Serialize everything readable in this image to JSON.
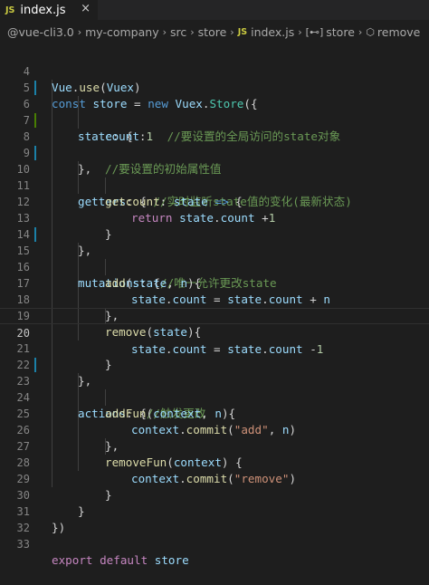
{
  "tab": {
    "icon_label": "JS",
    "title": "index.js",
    "close_glyph": "×"
  },
  "breadcrumb": {
    "items": [
      "@vue-cli3.0",
      "my-company",
      "src",
      "store"
    ],
    "file_icon": "JS",
    "file": "index.js",
    "symbol_store": "store",
    "symbol_remove": "remove"
  },
  "editor": {
    "active_line": 20,
    "lines": [
      {
        "n": "4",
        "git": ""
      },
      {
        "n": "5",
        "git": ""
      },
      {
        "n": "6",
        "git": "modified"
      },
      {
        "n": "7",
        "git": ""
      },
      {
        "n": "8",
        "git": "added"
      },
      {
        "n": "9",
        "git": ""
      },
      {
        "n": "10",
        "git": "modified"
      },
      {
        "n": "11",
        "git": ""
      },
      {
        "n": "12",
        "git": ""
      },
      {
        "n": "13",
        "git": ""
      },
      {
        "n": "14",
        "git": ""
      },
      {
        "n": "15",
        "git": "modified"
      },
      {
        "n": "16",
        "git": ""
      },
      {
        "n": "17",
        "git": ""
      },
      {
        "n": "18",
        "git": ""
      },
      {
        "n": "19",
        "git": ""
      },
      {
        "n": "20",
        "git": ""
      },
      {
        "n": "21",
        "git": ""
      },
      {
        "n": "22",
        "git": ""
      },
      {
        "n": "23",
        "git": "modified"
      },
      {
        "n": "24",
        "git": ""
      },
      {
        "n": "25",
        "git": ""
      },
      {
        "n": "26",
        "git": ""
      },
      {
        "n": "27",
        "git": ""
      },
      {
        "n": "28",
        "git": ""
      },
      {
        "n": "29",
        "git": ""
      },
      {
        "n": "30",
        "git": ""
      },
      {
        "n": "31",
        "git": ""
      },
      {
        "n": "32",
        "git": ""
      },
      {
        "n": "33",
        "git": ""
      }
    ]
  },
  "code": {
    "l4": [
      "Vue",
      ".",
      "use",
      "(",
      "Vuex",
      ")"
    ],
    "l5": [
      "const",
      " ",
      "store",
      " = ",
      "new",
      " ",
      "Vuex",
      ".",
      "Store",
      "({"
    ],
    "l6": [
      "state",
      ": {     ",
      "//要设置的全局访问的state对象"
    ],
    "l7": [
      "count",
      ":",
      "1"
    ],
    "l8": [
      "//要设置的初始属性值"
    ],
    "l9": [
      "},"
    ],
    "l10": [
      "getters",
      ": { ",
      "//实时监听state值的变化(最新状态)"
    ],
    "l11": [
      "getcount",
      ": ",
      "state",
      " ",
      "=>",
      " {"
    ],
    "l12": [
      "return",
      " ",
      "state",
      ".",
      "count",
      " +",
      "1"
    ],
    "l13": [
      "}"
    ],
    "l14": [
      "},"
    ],
    "l15": [
      "mutations",
      ": {",
      "//唯一允许更改state"
    ],
    "l16": [
      "add",
      "(",
      "state",
      ", ",
      "n",
      "){"
    ],
    "l17": [
      "state",
      ".",
      "count",
      " = ",
      "state",
      ".",
      "count",
      " + ",
      "n"
    ],
    "l18": [
      "},"
    ],
    "l19": [
      "remove",
      "(",
      "state",
      "){"
    ],
    "l20": [
      "state",
      ".",
      "count",
      " = ",
      "state",
      ".",
      "count",
      " -",
      "1"
    ],
    "l21": [
      "}"
    ],
    "l22": [
      "},"
    ],
    "l23": [
      "actions",
      ": {",
      "//触发更改"
    ],
    "l24": [
      "addFun",
      "(",
      "context",
      ", ",
      "n",
      "){"
    ],
    "l25": [
      "context",
      ".",
      "commit",
      "(",
      "\"add\"",
      ", ",
      "n",
      ")"
    ],
    "l26": [
      "},"
    ],
    "l27": [
      "removeFun",
      "(",
      "context",
      ") {"
    ],
    "l28": [
      "context",
      ".",
      "commit",
      "(",
      "\"remove\"",
      ")"
    ],
    "l29": [
      "}"
    ],
    "l30": [
      "}"
    ],
    "l31": [
      "})"
    ],
    "l32": [],
    "l33": [
      "export",
      " ",
      "default",
      " ",
      "store"
    ]
  },
  "colors": {
    "background": "#1e1e1e",
    "keyword": "#569cd6",
    "control_keyword": "#c586c0",
    "variable": "#9cdcfe",
    "function": "#dcdcaa",
    "class": "#4ec9b0",
    "number": "#b5cea8",
    "string": "#ce9178",
    "comment": "#6a9955",
    "git_modified": "#1b81a8",
    "git_added": "#487e02"
  }
}
